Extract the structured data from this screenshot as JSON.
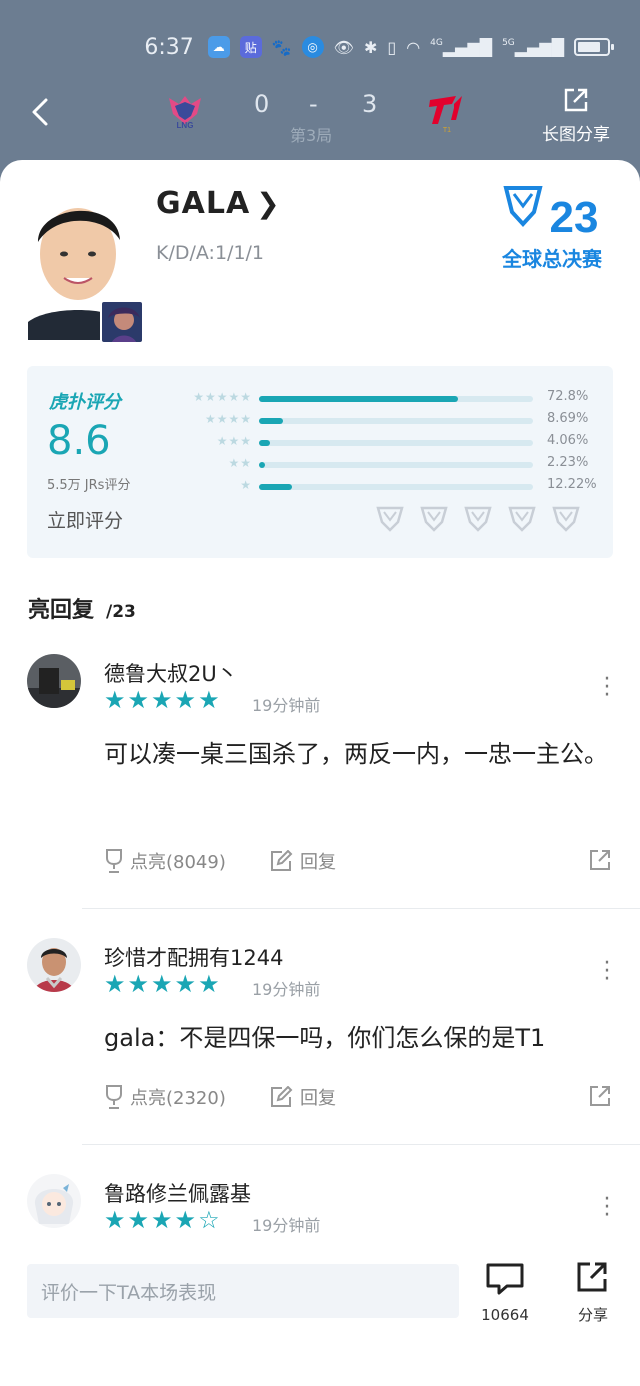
{
  "status_bar": {
    "time": "6:37",
    "icons": [
      "cloud-icon",
      "tieba-icon",
      "paw-icon",
      "browser-icon",
      "eye-icon",
      "bluetooth-icon",
      "vibrate-icon",
      "wifi-icon",
      "signal-4g-icon",
      "signal-5g-icon",
      "battery-icon"
    ],
    "network_1": "4G",
    "network_2": "5G"
  },
  "match": {
    "left_team_logo": "LNG",
    "right_team_logo": "T1",
    "left_score": "0",
    "dash": "-",
    "right_score": "3",
    "round": "第3局",
    "share_long_image": "长图分享"
  },
  "player": {
    "name": "GALA",
    "kda": "K/D/A:1/1/1",
    "event_badge_number": "23",
    "event_badge_text": "全球总决赛"
  },
  "rating": {
    "brand": "虎扑评分",
    "score": "8.6",
    "count": "5.5万 JRs评分",
    "rate_now": "立即评分",
    "distribution": [
      {
        "stars": "★★★★★",
        "percent": "72.8%",
        "value": 72.8
      },
      {
        "stars": "★★★★",
        "percent": "8.69%",
        "value": 8.69
      },
      {
        "stars": "★★★",
        "percent": "4.06%",
        "value": 4.06
      },
      {
        "stars": "★★",
        "percent": "2.23%",
        "value": 2.23
      },
      {
        "stars": "★",
        "percent": "12.22%",
        "value": 12.22
      }
    ],
    "trophy_count": 5
  },
  "replies": {
    "title": "亮回复",
    "count": "/23"
  },
  "comments": [
    {
      "user": "德鲁大叔2U丶",
      "rating_stars": "★★★★★",
      "time": "19分钟前",
      "text": "可以凑一桌三国杀了，两反一内，一忠一主公。",
      "like": "点亮(8049)",
      "reply": "回复"
    },
    {
      "user": "珍惜才配拥有1244",
      "rating_stars": "★★★★★",
      "time": "19分钟前",
      "text": "gala：不是四保一吗，你们怎么保的是T1",
      "like": "点亮(2320)",
      "reply": "回复"
    },
    {
      "user": "鲁路修兰佩露基",
      "rating_stars": "★★★★☆",
      "time": "19分钟前"
    }
  ],
  "bottom_bar": {
    "input_placeholder": "评价一下TA本场表现",
    "comment_count": "10664",
    "share_label": "分享"
  },
  "colors": {
    "accent": "#1aa6b4",
    "header_bg": "#6c7d91",
    "rating_bg": "#f1f6fa"
  }
}
